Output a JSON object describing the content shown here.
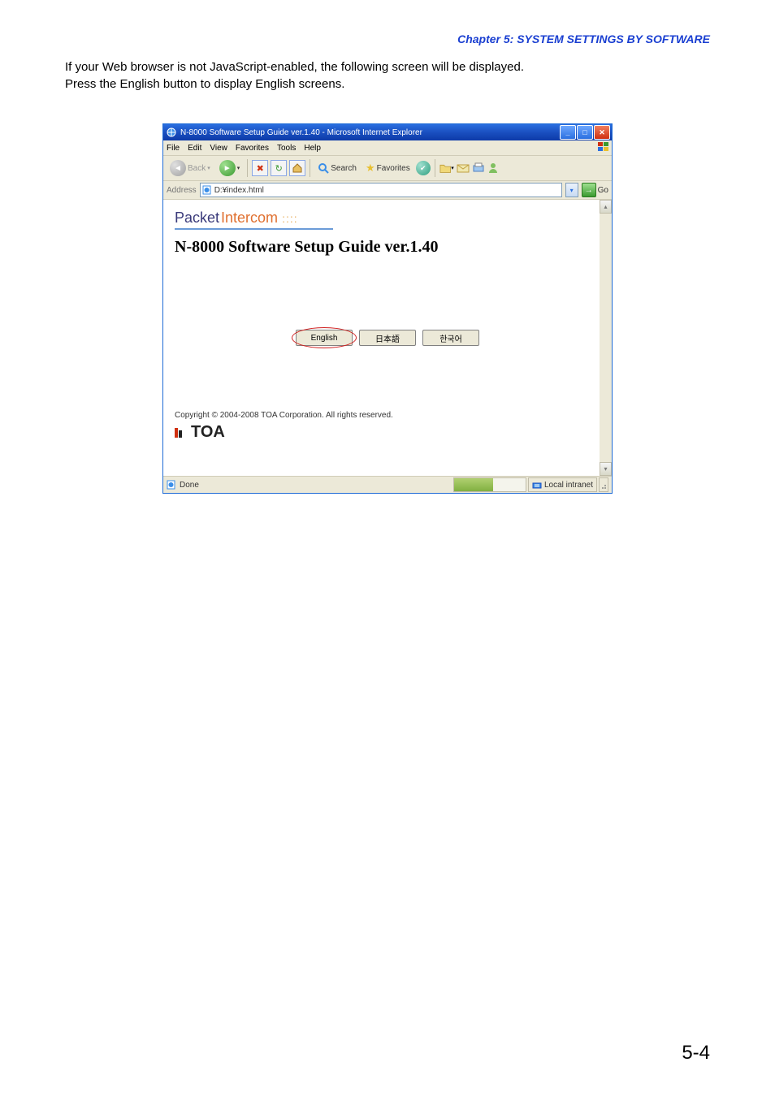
{
  "chapter_heading": "Chapter 5:  SYSTEM SETTINGS BY SOFTWARE",
  "body_line1": "If your Web browser is not JavaScript-enabled, the following screen will be displayed.",
  "body_line2": "Press the English button to display English screens.",
  "page_number": "5-4",
  "window": {
    "title": "N-8000 Software Setup Guide ver.1.40 - Microsoft Internet Explorer",
    "menubar": {
      "file": "File",
      "edit": "Edit",
      "view": "View",
      "favorites": "Favorites",
      "tools": "Tools",
      "help": "Help"
    },
    "toolbar": {
      "back": "Back",
      "search": "Search",
      "favorites": "Favorites"
    },
    "addressbar": {
      "label": "Address",
      "value": "D:¥index.html",
      "go": "Go"
    },
    "content": {
      "logo_packet": "Packet",
      "logo_intercom": "Intercom",
      "guide_title": "N-8000 Software Setup Guide ver.1.40",
      "lang_english": "English",
      "lang_japanese": "日本語",
      "lang_korean": "한국어",
      "copyright": "Copyright © 2004-2008 TOA Corporation. All rights reserved.",
      "toa_text": "TOA"
    },
    "statusbar": {
      "done": "Done",
      "zone": "Local intranet"
    }
  }
}
